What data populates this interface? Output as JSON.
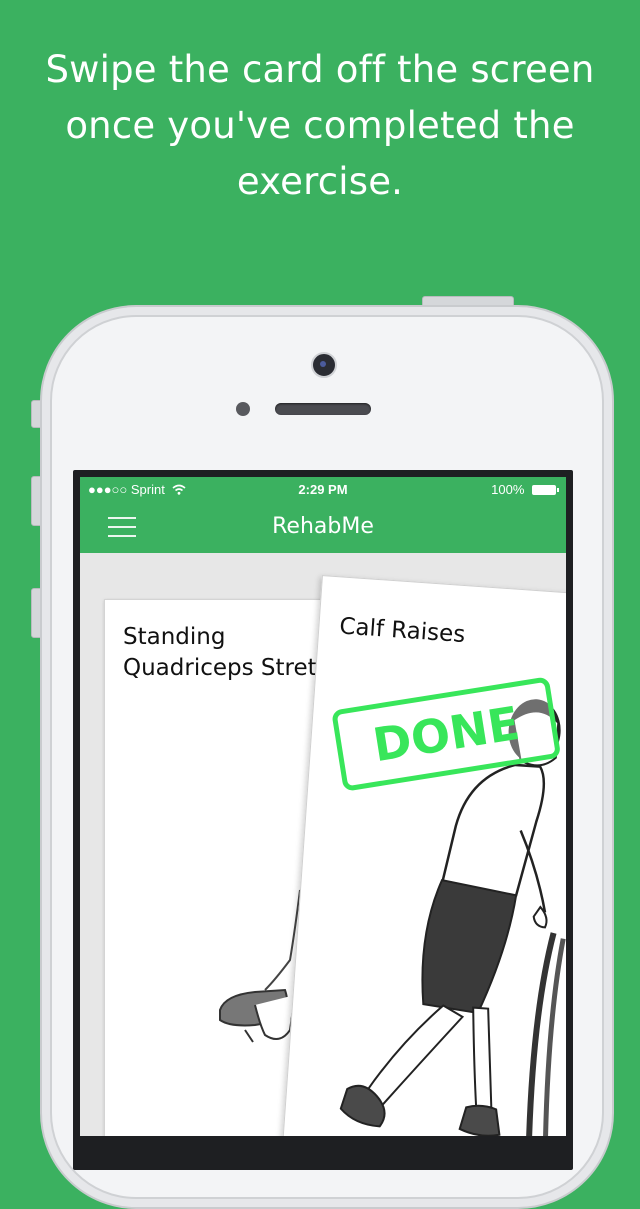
{
  "headline": {
    "line1": "Swipe the card off the screen",
    "line2": "once you've completed the",
    "line3": "exercise."
  },
  "status_bar": {
    "signal": "●●●○○",
    "carrier": "Sprint",
    "time": "2:29 PM",
    "battery": "100%"
  },
  "nav": {
    "title": "RehabMe",
    "menu_icon": "hamburger-menu-icon"
  },
  "cards": {
    "back_title_line1": "Standing",
    "back_title_line2": "Quadriceps Stret",
    "front_title": "Calf Raises",
    "stamp": "DONE"
  },
  "colors": {
    "brand_green": "#3bb160",
    "stamp_green": "#38e65a"
  }
}
